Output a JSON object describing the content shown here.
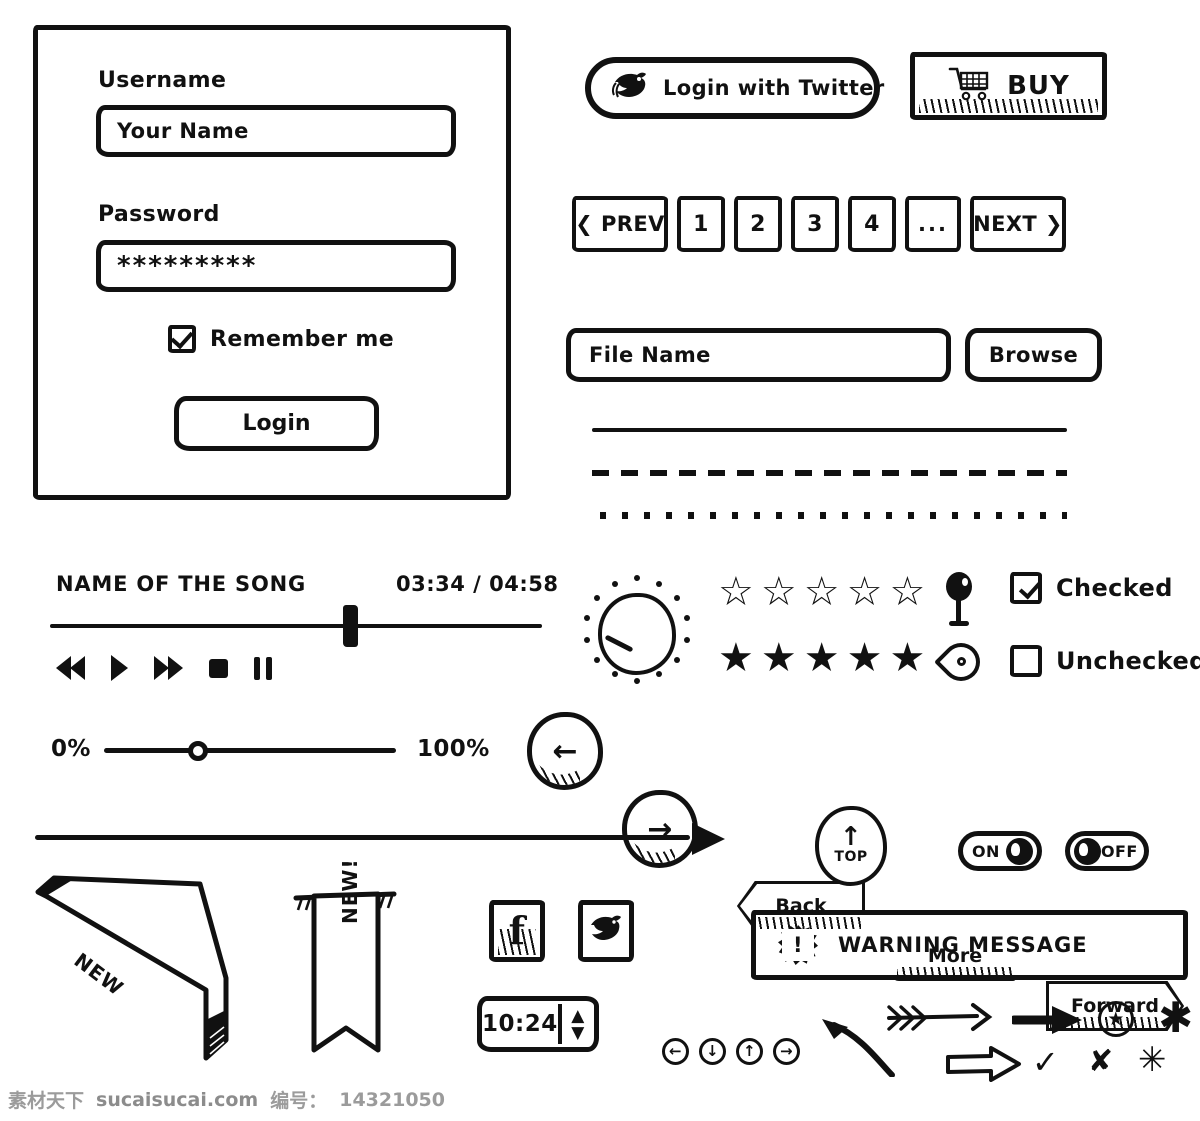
{
  "login_form": {
    "username_label": "Username",
    "username_value": "Your Name",
    "password_label": "Password",
    "password_value": "*********",
    "remember_label": "Remember me",
    "login_button": "Login"
  },
  "social": {
    "twitter_login_label": "Login with Twitter",
    "twitter_icon": "twitter-bird-icon",
    "buy_label": "BUY",
    "cart_icon": "shopping-cart-icon",
    "facebook_icon": "facebook-icon",
    "facebook_glyph": "f",
    "twitter_square_icon": "twitter-bird-icon"
  },
  "pagination": {
    "prev_label": "❮ PREV",
    "pages": [
      "1",
      "2",
      "3",
      "4"
    ],
    "ellipsis": "...",
    "next_label": "NEXT ❯"
  },
  "file_picker": {
    "filename_value": "File Name",
    "browse_label": "Browse"
  },
  "dividers": {
    "solid": "solid-divider",
    "dashed": "dashed-divider",
    "dotted": "dotted-divider"
  },
  "player": {
    "song_title": "NAME OF THE SONG",
    "time": "03:34 / 04:58",
    "progress_percent": 60,
    "controls": [
      "rewind",
      "play",
      "fast-forward",
      "stop",
      "pause"
    ]
  },
  "knob": {
    "name": "rotary-knob",
    "dot_count": 14
  },
  "rating": {
    "empty_star": "☆",
    "full_star": "★",
    "empty_count": 5,
    "full_count": 5
  },
  "pins": {
    "filled": "map-pin-filled-icon",
    "outline": "map-pin-outline-icon"
  },
  "checkboxes": {
    "checked_label": "Checked",
    "unchecked_label": "Unchecked"
  },
  "slider": {
    "min_label": "0%",
    "max_label": "100%",
    "value_percent": 29
  },
  "nav_buttons": {
    "circle_left": "←",
    "circle_right": "→",
    "back_label": "Back",
    "more_label": "More",
    "forward_label": "Forward"
  },
  "misc": {
    "long_arrow": "long-right-arrow",
    "top_arrow": "↑",
    "top_label": "TOP"
  },
  "toggles": {
    "on_label": "ON",
    "off_label": "OFF"
  },
  "ribbons": {
    "corner_label": "NEW",
    "banner_label": "NEW!"
  },
  "time_stepper": {
    "value": "10:24",
    "up_arrow": "▲",
    "down_arrow": "▼"
  },
  "warning": {
    "icon": "warning-burst-icon",
    "bang": "!",
    "label": "WARNING MESSAGE"
  },
  "mini_arrows": {
    "left": "←",
    "down": "↓",
    "up": "↑",
    "right": "→"
  },
  "symbols": {
    "circled_star": "★",
    "asterisk_top": "✱",
    "asterisk_bottom": "✳",
    "check": "✓",
    "cross": "✘"
  },
  "footer": {
    "brand": "素材天下",
    "site": "sucaisucai.com",
    "id_label": "编号：",
    "id_value": "14321050"
  },
  "colors": {
    "ink": "#111111",
    "paper": "#ffffff",
    "footer_text": "#9b9b9b"
  }
}
